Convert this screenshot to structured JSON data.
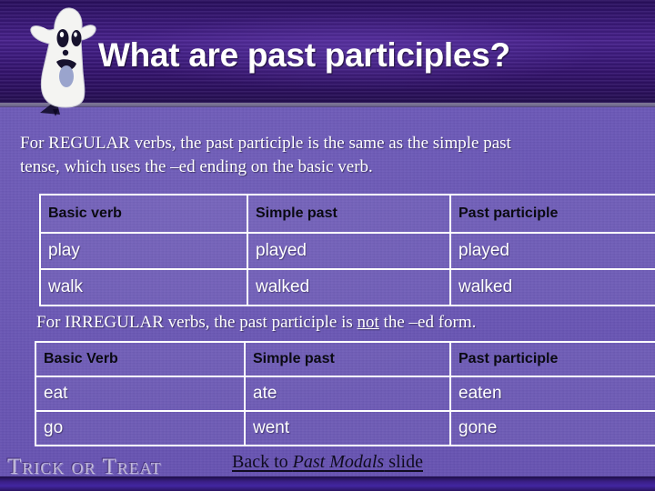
{
  "slide": {
    "title": "What are past participles?",
    "mascot_icon": "ghost-icon",
    "decorative_text": "Trick or Treat"
  },
  "body": {
    "regular_intro_line1": "For REGULAR verbs, the past participle is the same as the simple past",
    "regular_intro_line2_a": "tense, which uses the –ed ending on the basic verb.",
    "irregular_intro_a": "For IRREGULAR verbs, the past participle is ",
    "irregular_intro_underlined": "not",
    "irregular_intro_b": " the –ed form."
  },
  "table_regular": {
    "headers": [
      "Basic verb",
      "Simple past",
      "Past participle"
    ],
    "rows": [
      [
        "play",
        "played",
        "played"
      ],
      [
        "walk",
        "walked",
        "walked"
      ]
    ]
  },
  "table_irregular": {
    "headers": [
      "Basic Verb",
      "Simple past",
      "Past participle"
    ],
    "rows": [
      [
        "eat",
        "ate",
        "eaten"
      ],
      [
        "go",
        "went",
        "gone"
      ]
    ]
  },
  "footer": {
    "link_prefix": "Back to ",
    "link_italic": "Past Modals",
    "link_suffix": " slide"
  },
  "colors": {
    "banner_dark": "#2b1060",
    "body_purple": "#6a57b6",
    "table_border": "#ffffff",
    "header_text": "#0a0a12",
    "body_text": "#ffffff",
    "link_text": "#100c20"
  }
}
